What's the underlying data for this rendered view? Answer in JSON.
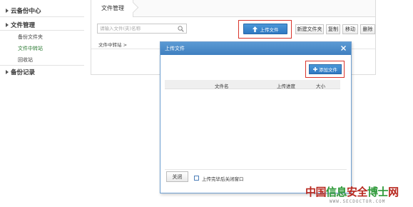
{
  "sidebar": {
    "sections": [
      {
        "label": "云备份中心",
        "expanded": false
      },
      {
        "label": "文件管理",
        "expanded": true
      },
      {
        "label": "备份记录",
        "expanded": false
      }
    ],
    "items": [
      {
        "label": "备份文件夹",
        "active": false
      },
      {
        "label": "文件中转站",
        "active": true
      },
      {
        "label": "回收站",
        "active": false
      }
    ]
  },
  "main": {
    "tab_title": "文件管理",
    "search": {
      "placeholder": "请输入文件(夹)名称",
      "value": ""
    },
    "toolbar": {
      "upload_label": "上传文件",
      "new_folder_label": "新建文件夹",
      "copy_label": "复制",
      "move_label": "移动",
      "delete_label": "删除"
    },
    "breadcrumb": "文件中转站 >"
  },
  "dialog": {
    "title": "上传文件",
    "add_file_label": "添加文件",
    "columns": [
      "文件名",
      "上传进度",
      "大小"
    ],
    "rows": [],
    "close_label": "关闭",
    "auto_close_label": "上传完毕后关闭窗口",
    "auto_close_checked": false
  },
  "watermark": {
    "text_red_1": "中国",
    "text_green_1": "信息",
    "text_red_2": "安全",
    "text_green_2": "博士",
    "text_red_3": "网",
    "url": "WWW.SECDOCTOR.COM"
  },
  "colors": {
    "accent_blue": "#3a86cc",
    "highlight_red": "#d9342b",
    "active_green": "#2a7a32"
  }
}
